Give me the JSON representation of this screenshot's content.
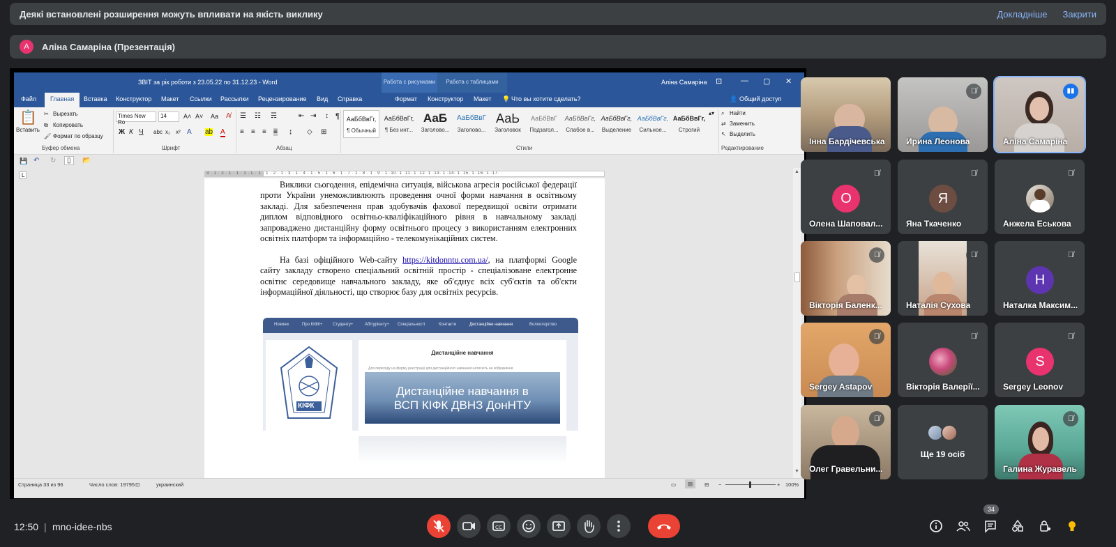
{
  "banner": {
    "message": "Деякі встановлені розширення можуть впливати на якість виклику",
    "details_link": "Докладніше",
    "close_link": "Закрити"
  },
  "presenter": {
    "initial": "А",
    "name": "Аліна Самаріна (Презентація)"
  },
  "word": {
    "title": "ЗВІТ за рік роботи з 23.05.22 по 31.12.23  -  Word",
    "context_tab_1": "Работа с рисунками",
    "context_tab_2": "Работа с таблицами",
    "user": "Аліна Самаріна",
    "tabs": [
      "Файл",
      "Главная",
      "Вставка",
      "Конструктор",
      "Макет",
      "Ссылки",
      "Рассылки",
      "Рецензирование",
      "Вид",
      "Справка",
      "Формат",
      "Конструктор",
      "Макет"
    ],
    "tell_me": "Что вы хотите сделать?",
    "share": "Общий доступ",
    "clipboard": {
      "paste": "Вставить",
      "cut": "Вырезать",
      "copy": "Копировать",
      "format_painter": "Формат по образцу",
      "group": "Буфер обмена"
    },
    "font": {
      "name": "Times New Ro",
      "size": "14",
      "group": "Шрифт"
    },
    "paragraph_group": "Абзац",
    "styles_group": "Стили",
    "styles": [
      {
        "preview": "АаБбВвГг,",
        "label": "¶ Обычный"
      },
      {
        "preview": "АаБбВвГг,",
        "label": "¶ Без инт..."
      },
      {
        "preview": "АаБ",
        "label": "Заголово..."
      },
      {
        "preview": "АаБбВвГ",
        "label": "Заголово..."
      },
      {
        "preview": "АаЬ",
        "label": "Заголовок"
      },
      {
        "preview": "АаБбВвГ",
        "label": "Подзагол..."
      },
      {
        "preview": "АаБбВвГг,",
        "label": "Слабое в..."
      },
      {
        "preview": "АаБбВвГг,",
        "label": "Выделение"
      },
      {
        "preview": "АаБбВвГг,",
        "label": "Сильное..."
      },
      {
        "preview": "АаБбВвГг,",
        "label": "Строгий"
      }
    ],
    "editing": {
      "find": "Найти",
      "replace": "Заменить",
      "select": "Выделить",
      "group": "Редактирование"
    },
    "ruler_text": "3 · 1 · 2 · 1 · 1 · 1 · L · 1 · 1 · 2 · 1 · 3 · 1 · 4 · 1 · 5 · 1 · 6 · 1 · 7 · 1 · 8 · 1 · 9 · 1 ·10· 1 ·11· 1 ·12· 1 ·13· 1 ·14· 1 ·15· 1 ·16· 1 ·17·",
    "paragraph_1": "Виклики сьогодення, епідемічна ситуація, військова агресія російської федерації проти України унеможливлюють проведення очної форми навчання в освітньому закладі. Для забезпечення прав здобувачів фахової передвищої освіти отримати диплом відповідного освітньо-кваліфікаційного рівня в навчальному закладі запроваджено дистанційну форму освітнього процесу з використанням електронних освітніх платформ та інформаційно - телекомунікаційних систем.",
    "paragraph_2_before": "На базі офіційного Web-сайту ",
    "paragraph_2_link": "https://kitdonntu.com.ua/",
    "paragraph_2_after": ", на платформі Google сайту закладу створено спеціальний освітній простір - спеціалізоване електронне освітнє середовище навчального закладу, яке об'єднує всіх суб'єктів та об'єкти інформаційної діяльності, що створює базу для освітніх ресурсів.",
    "site_nav": [
      "Новини",
      "Про КІФК+",
      "Студенту+",
      "Абітурієнту+",
      "Спеціальності",
      "Контакти",
      "Дистанційне навчання",
      "Волонтерство"
    ],
    "site_heading": "Дистанційне навчання",
    "site_subtext": "Для переходу на форму реєстрації для дистанційного навчання натисніть на зображення",
    "site_banner_line1": "Дистанційне навчання в",
    "site_banner_line2": "ВСП КІФК ДВНЗ ДонНТУ",
    "site_logo_text": "КІФК",
    "status": {
      "page": "Страница 33 из 96",
      "words": "Число слов: 19795",
      "language": "украинский",
      "zoom": "100%"
    }
  },
  "participants": [
    {
      "name": "Інна Бардічевська",
      "muted": false,
      "kind": "video"
    },
    {
      "name": "Ирина Леонова",
      "muted": true,
      "kind": "video"
    },
    {
      "name": "Аліна Самаріна",
      "muted": false,
      "kind": "video",
      "speaking": true
    },
    {
      "name": "Олена Шаповал...",
      "muted": true,
      "kind": "letter",
      "letter": "О",
      "color": "#e8336f"
    },
    {
      "name": "Яна Ткаченко",
      "muted": true,
      "kind": "letter",
      "letter": "Я",
      "color": "#6d4c41"
    },
    {
      "name": "Анжела Еськова",
      "muted": true,
      "kind": "avatar"
    },
    {
      "name": "Вікторія Баленк...",
      "muted": true,
      "kind": "video"
    },
    {
      "name": "Наталія Сухова",
      "muted": true,
      "kind": "video"
    },
    {
      "name": "Наталка Максим...",
      "muted": true,
      "kind": "letter",
      "letter": "Н",
      "color": "#5e35b1"
    },
    {
      "name": "Sergey Astapov",
      "muted": true,
      "kind": "video"
    },
    {
      "name": "Вікторія Валерії...",
      "muted": true,
      "kind": "avatar"
    },
    {
      "name": "Sergey Leonov",
      "muted": true,
      "kind": "letter",
      "letter": "S",
      "color": "#e8336f"
    },
    {
      "name": "Олег Гравельни...",
      "muted": true,
      "kind": "video"
    },
    {
      "name": "Ще 19 осіб",
      "muted": false,
      "kind": "more"
    },
    {
      "name": "Галина Журавель",
      "muted": true,
      "kind": "video"
    }
  ],
  "bottom": {
    "time": "12:50",
    "separator": "|",
    "meeting_code": "mno-idee-nbs",
    "people_count": "34"
  }
}
